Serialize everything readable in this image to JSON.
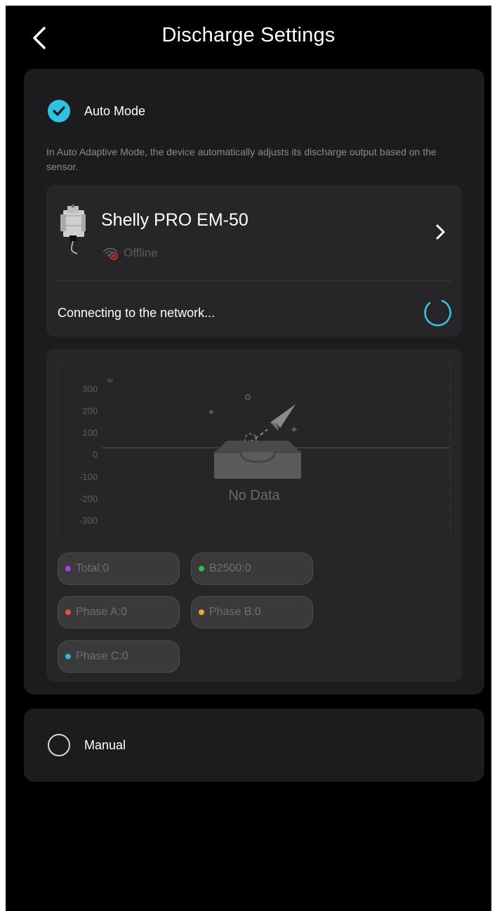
{
  "header": {
    "title": "Discharge Settings"
  },
  "auto_mode": {
    "label": "Auto Mode",
    "selected": true,
    "description": "In Auto Adaptive Mode, the device automatically adjusts its discharge output based on the sensor."
  },
  "device": {
    "name": "Shelly PRO EM-50",
    "status": "Offline",
    "connection_status": "Connecting to the network..."
  },
  "chart": {
    "unit": "w",
    "y_ticks": [
      "300",
      "200",
      "100",
      "0",
      "-100",
      "-200",
      "-300"
    ],
    "empty_text": "No Data"
  },
  "chart_data": {
    "type": "line",
    "ylabel": "w",
    "ylim": [
      -300,
      300
    ],
    "y_ticks": [
      300,
      200,
      100,
      0,
      -100,
      -200,
      -300
    ],
    "grid": true,
    "series": []
  },
  "legend": [
    {
      "label": "Total:0",
      "color": "#b63ad9"
    },
    {
      "label": "B2500:0",
      "color": "#27c04a"
    },
    {
      "label": "Phase A:0",
      "color": "#e84b43"
    },
    {
      "label": "Phase B:0",
      "color": "#f2a81d"
    },
    {
      "label": "Phase C:0",
      "color": "#2bb4d6"
    }
  ],
  "manual_mode": {
    "label": "Manual",
    "selected": false
  },
  "colors": {
    "accent": "#2ec2e3",
    "background": "#000000",
    "card": "#1c1c1e",
    "offline": "#c23b3b"
  }
}
